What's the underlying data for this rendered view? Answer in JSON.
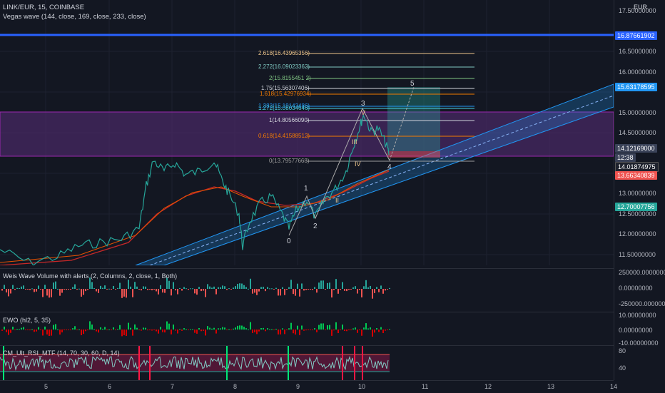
{
  "header": {
    "symbol_line": "LINK/EUR, 15, COINBASE",
    "indicator_line": "Vegas wave (144, close, 169, close, 233, close)"
  },
  "currency": "EUR",
  "price_axis": {
    "ticks": [
      "17.50000000",
      "17.00000000",
      "16.50000000",
      "16.00000000",
      "15.50000000",
      "15.00000000",
      "14.50000000",
      "14.00000000",
      "13.50000000",
      "13.00000000",
      "12.50000000",
      "12.00000000",
      "11.50000000"
    ],
    "badges": [
      {
        "label": "16.87661902",
        "color": "#2962ff"
      },
      {
        "label": "15.63178595",
        "color": "#2196f3"
      },
      {
        "label": "14.12169000",
        "color": "#3a4258"
      },
      {
        "label": "12:38",
        "color": "#3a4258"
      },
      {
        "label": "14.01874975",
        "color": "#1e222d"
      },
      {
        "label": "13.66340839",
        "color": "#ef5350"
      },
      {
        "label": "12.70007756",
        "color": "#26a69a"
      }
    ]
  },
  "fib_levels": [
    {
      "label": "2.618(16.43965356)",
      "color": "#f0c78c"
    },
    {
      "label": "2.272(16.09023362)",
      "color": "#80cbc4"
    },
    {
      "label": "2(15.8155451 2)",
      "color": "#81c784"
    },
    {
      "label": "1.75(15.56307406)",
      "color": "#d1d4dc"
    },
    {
      "label": "1.618(15.42976934)",
      "color": "#f57c00"
    },
    {
      "label": "1.382(15.19143486)",
      "color": "#2196f3"
    },
    {
      "label": "1.272(15.08034646)",
      "color": "#4dd0e1"
    },
    {
      "label": "1(14.80566090)",
      "color": "#d1d4dc"
    },
    {
      "label": "0.618(14.41588512)",
      "color": "#f57c00"
    },
    {
      "label": "0(13.79577668)",
      "color": "#9e9e9e"
    }
  ],
  "waves": {
    "primary": [
      "0",
      "1",
      "2",
      "3",
      "4",
      "5"
    ],
    "secondary": [
      "II",
      "III",
      "IV",
      "V"
    ]
  },
  "panes": [
    {
      "legend": "Weis Wave Volume with alerts (2, Columns, 2, close, 1, Both)",
      "ticks": [
        "250000.00000000",
        "0.00000000",
        "-250000.00000000"
      ]
    },
    {
      "legend": "EWO (hl2, 5, 35)",
      "ticks": [
        "10.00000000",
        "0.00000000",
        "-10.00000000"
      ]
    },
    {
      "legend": "CM_Ult_RSI_MTF (14, 70, 30, 60, D, 14)",
      "ticks": [
        "80",
        "40"
      ]
    }
  ],
  "time_axis": [
    "5",
    "6",
    "7",
    "8",
    "9",
    "10",
    "11",
    "12",
    "13",
    "14"
  ]
}
